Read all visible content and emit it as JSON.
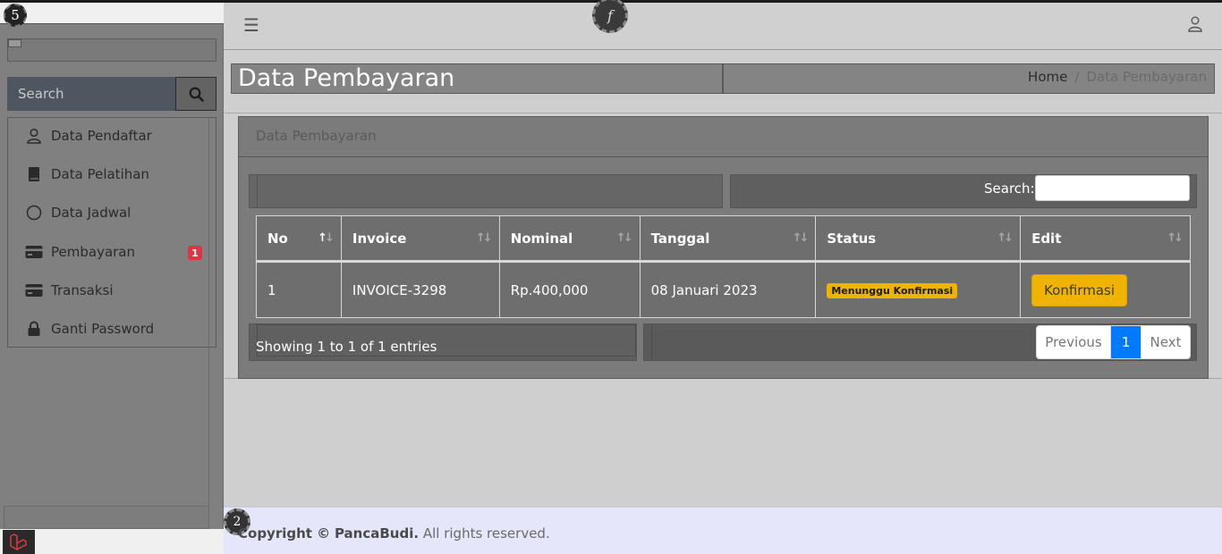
{
  "header": {
    "menu_icon": "hamburger-icon",
    "user_icon": "user-icon",
    "circle_label": "f"
  },
  "sidebar": {
    "top_marker": "5",
    "search_placeholder": "Search",
    "items": [
      {
        "label": "Data Pendaftar",
        "icon": "user-icon"
      },
      {
        "label": "Data Pelatihan",
        "icon": "book-icon"
      },
      {
        "label": "Data Jadwal",
        "icon": "circle-icon"
      },
      {
        "label": "Pembayaran",
        "icon": "credit-card-icon",
        "badge": "1"
      },
      {
        "label": "Transaksi",
        "icon": "credit-card-icon"
      },
      {
        "label": "Ganti Password",
        "icon": "lock-icon"
      }
    ]
  },
  "page": {
    "title": "Data Pembayaran",
    "breadcrumb": {
      "home": "Home",
      "separator": "/",
      "current": "Data Pembayaran"
    }
  },
  "card": {
    "title": "Data Pembayaran",
    "search_label": "Search:",
    "columns": [
      "No",
      "Invoice",
      "Nominal",
      "Tanggal",
      "Status",
      "Edit"
    ],
    "rows": [
      {
        "no": "1",
        "invoice": "INVOICE-3298",
        "nominal": "Rp.400,000",
        "tanggal": "08 Januari 2023",
        "status": "Menunggu Konfirmasi",
        "action": "Konfirmasi"
      }
    ],
    "info": "Showing 1 to 1 of 1 entries",
    "pager": {
      "previous": "Previous",
      "page": "1",
      "next": "Next"
    }
  },
  "footer": {
    "marker": "2",
    "copyright": "Copyright ©",
    "brand": "PancaBudi.",
    "rights": "All rights reserved."
  },
  "colors": {
    "accent": "#007bff",
    "warning": "#f0b400",
    "danger": "#dc3545",
    "footer_bg": "#e6e6fa"
  }
}
